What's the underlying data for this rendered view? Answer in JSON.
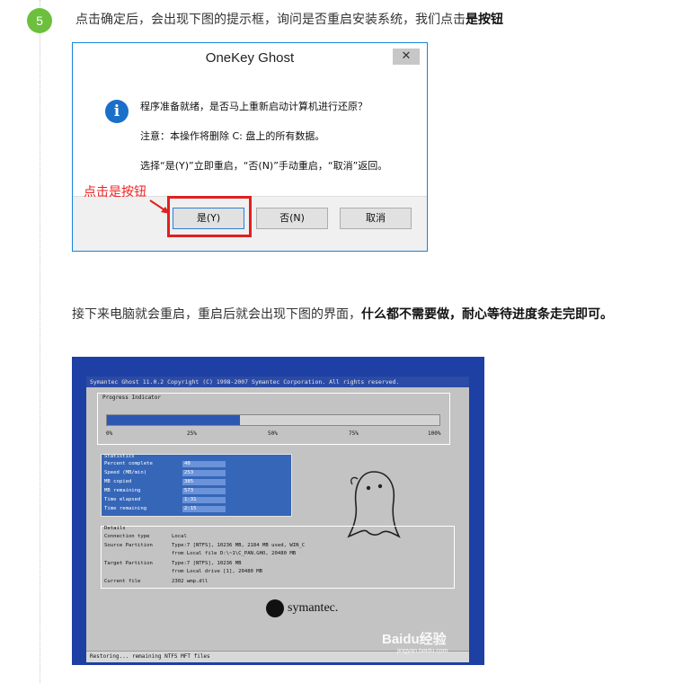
{
  "step": {
    "number": "5",
    "text_prefix": "点击确定后，会出现下图的提示框，询问是否重启安装系统，我们点击",
    "text_bold": "是按钮"
  },
  "dialog": {
    "title": "OneKey Ghost",
    "close_glyph": "✕",
    "icon_glyph": "i",
    "line1": "程序准备就绪，是否马上重新启动计算机进行还原？",
    "line2": "注意：本操作将删除 C: 盘上的所有数据。",
    "line3": "选择“是(Y)”立即重启，“否(N)”手动重启，“取消”返回。",
    "buttons": {
      "yes": "是(Y)",
      "no": "否(N)",
      "cancel": "取消"
    },
    "annotation": "点击是按钮"
  },
  "paragraph2": {
    "text_normal": "接下来电脑就会重启，重启后就会出现下图的界面，",
    "text_bold": "什么都不需要做，耐心等待进度条走完即可。"
  },
  "ghost": {
    "title": "Symantec Ghost 11.0.2    Copyright (C) 1998-2007 Symantec Corporation. All rights reserved.",
    "progress_label": "Progress Indicator",
    "progress_fraction": 0.4,
    "progress_ticks": [
      "0%",
      "25%",
      "50%",
      "75%",
      "100%"
    ],
    "statistics_label": "Statistics",
    "stats": [
      {
        "label": "Percent complete",
        "value": "40"
      },
      {
        "label": "Speed (MB/min)",
        "value": "253"
      },
      {
        "label": "MB copied",
        "value": "385"
      },
      {
        "label": "MB remaining",
        "value": "573"
      },
      {
        "label": "Time elapsed",
        "value": "1:31"
      },
      {
        "label": "Time remaining",
        "value": "2:15"
      }
    ],
    "details_label": "Details",
    "details": [
      {
        "label": "Connection type",
        "value": "Local"
      },
      {
        "label": "Source Partition",
        "value": "Type:7 [NTFS], 10236 MB, 2184 MB used, WIN_C"
      },
      {
        "label": "",
        "value": "from Local file D:\\~1\\C_PAN.GHO, 20480 MB"
      },
      {
        "label": "Target Partition",
        "value": "Type:7 [NTFS], 10236 MB"
      },
      {
        "label": "",
        "value": "from Local drive [1], 20480 MB"
      },
      {
        "label": "Current file",
        "value": "2302 wmp.dll"
      }
    ],
    "brand": "symantec.",
    "status": "Restoring... remaining NTFS MFT files",
    "watermark": "Baidu经验",
    "watermark_sub": "jingyan.baidu.com"
  }
}
